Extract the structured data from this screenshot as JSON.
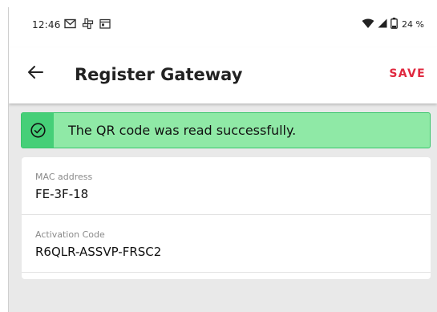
{
  "status_bar": {
    "time": "12:46",
    "battery": "24 %",
    "icons": [
      "gmail-icon",
      "pinwheel-icon",
      "calendar-icon",
      "wifi-icon",
      "signal-icon",
      "battery-icon"
    ]
  },
  "app_bar": {
    "title": "Register Gateway",
    "save_label": "SAVE",
    "back_icon": "arrow-back-icon"
  },
  "banner": {
    "message": "The QR code was read successfully.",
    "icon": "check-circle-icon"
  },
  "form": {
    "fields": [
      {
        "label": "MAC address",
        "value": "FE-3F-18"
      },
      {
        "label": "Activation Code",
        "value": "R6QLR-ASSVP-FRSC2"
      }
    ]
  },
  "colors": {
    "accent": "#e0283f",
    "success_bg": "#8fe9a6",
    "success_border": "#39c66b",
    "page_bg": "#e9e9e9"
  }
}
